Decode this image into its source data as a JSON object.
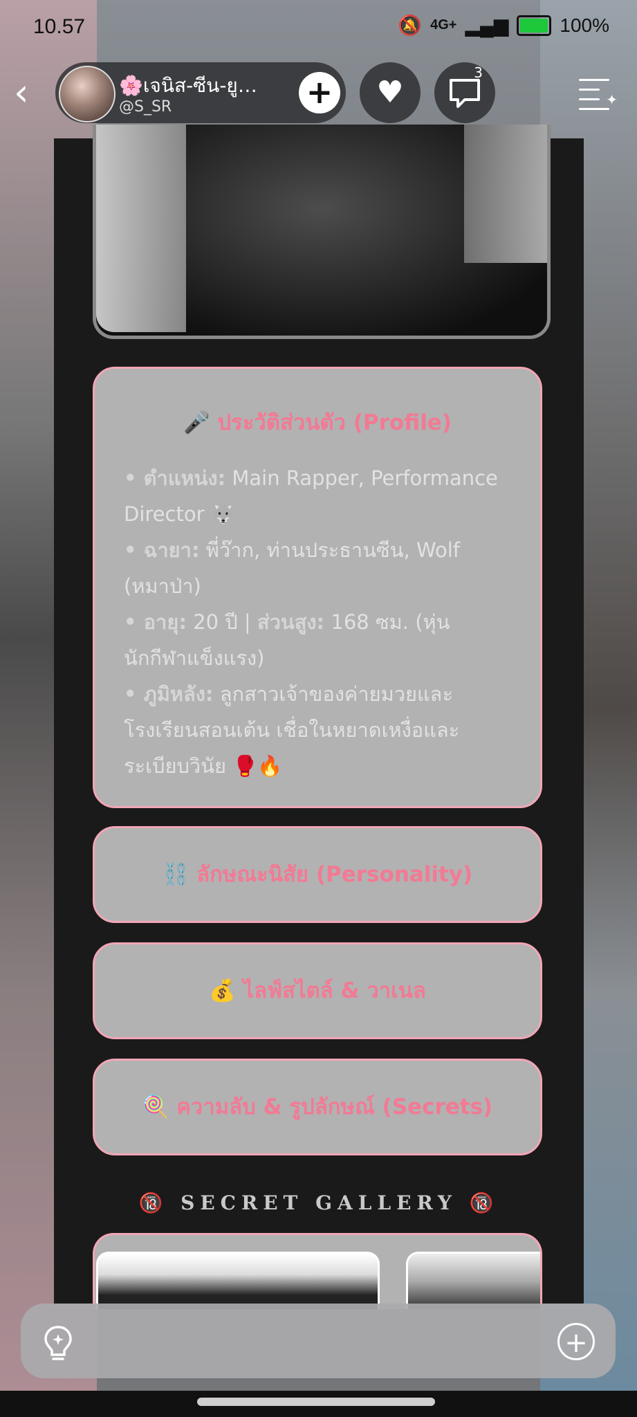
{
  "status_bar": {
    "time": "10.57",
    "network": "4G+",
    "battery": "100%"
  },
  "header": {
    "name": "🌸เจนิส-ซีน-ยูกิ...",
    "handle": "@S_SR",
    "comment_count": "3"
  },
  "profile_card": {
    "title": "🎤 ประวัติส่วนตัว (Profile)",
    "lines": [
      {
        "label": "• ตำแหน่ง:",
        "value": " Main Rapper, Performance Director 🐺"
      },
      {
        "label": "• ฉายา:",
        "value": " พี่ว๊าก, ท่านประธานซีน, Wolf (หมาป่า)"
      },
      {
        "label": "• อายุ:",
        "value": " 20 ปี | "
      },
      {
        "label": "ส่วนสูง:",
        "value": " 168 ซม. (หุ่นนักกีฬาแข็งแรง)"
      },
      {
        "label": "• ภูมิหลัง:",
        "value": " ลูกสาวเจ้าของค่ายมวยและโรงเรียนสอนเต้น เชื่อในหยาดเหงื่อและระเบียบวินัย 🥊🔥"
      }
    ]
  },
  "sections": {
    "personality": "⛓️ ลักษณะนิสัย (Personality)",
    "lifestyle": "💰 ไลฟ์สไตล์ & วาเนล",
    "secrets": "🍭 ความลับ & รูปลักษณ์ (Secrets)"
  },
  "gallery": {
    "title": "🔞 SECRET GALLERY 🔞"
  },
  "colors": {
    "accent_pink": "#f27a94",
    "card_border": "#f2a6b6",
    "card_bg": "#b2b2b2"
  }
}
